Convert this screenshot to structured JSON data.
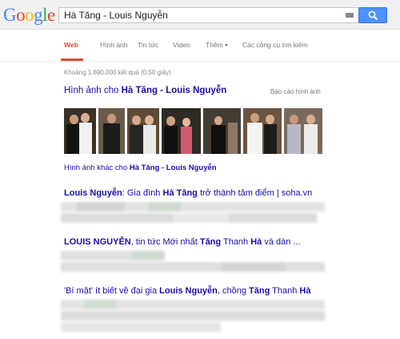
{
  "logo": {
    "letters": [
      "G",
      "o",
      "o",
      "g",
      "l",
      "e"
    ]
  },
  "search": {
    "query": "Hà Tăng - Louis Nguyễn"
  },
  "tabs": [
    {
      "label": "Web",
      "active": true
    },
    {
      "label": "Hình ảnh"
    },
    {
      "label": "Tin tức"
    },
    {
      "label": "Video"
    },
    {
      "label": "Thêm"
    },
    {
      "label": "Các công cụ tìm kiếm"
    }
  ],
  "results": {
    "stats": "Khoảng 1.690.000 kết quả (0,50 giây)",
    "images": {
      "heading_prefix": "Hình ảnh cho",
      "heading_query": "Hà Tăng - Louis Nguyễn",
      "report": "Báo cáo hình ảnh",
      "more_prefix": "Hình ảnh khác cho",
      "more_query": "Hà Tăng - Louis Nguyễn"
    },
    "items": [
      {
        "title_parts": [
          "Louis Nguyễn",
          ": Gia đình ",
          "Hà Tăng",
          " trở thành tâm điểm | soha.vn"
        ]
      },
      {
        "title_parts": [
          "LOUIS NGUYỄN",
          ", tin tức Mới nhất ",
          "Tăng",
          " Thanh ",
          "Hà",
          " và dàn ..."
        ]
      },
      {
        "title_parts": [
          "'Bí mật' ít biết về đại gia ",
          "Louis Nguyễn",
          ", chồng ",
          "Tăng",
          " Thanh ",
          "Hà"
        ]
      }
    ]
  },
  "colors": {
    "link": "#1a0dab",
    "active_tab": "#dd4b39",
    "search_button": "#4d90fe"
  }
}
